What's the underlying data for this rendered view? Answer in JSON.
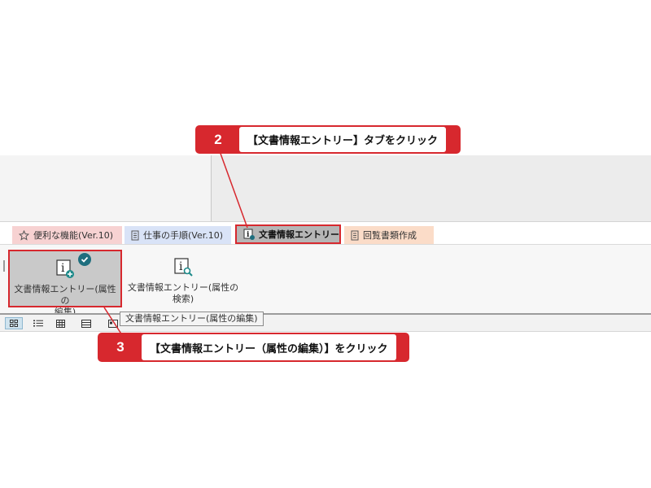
{
  "callouts": {
    "step2": {
      "number": "2",
      "text": "【文書情報エントリー】タブをクリック"
    },
    "step3": {
      "number": "3",
      "text": "【文書情報エントリー（属性の編集）】をクリック"
    }
  },
  "tabs": [
    {
      "label": "便利な機能(Ver.10)",
      "icon": "star-icon",
      "color": "#f7d2d2"
    },
    {
      "label": "仕事の手順(Ver.10)",
      "icon": "document-icon",
      "color": "#d9e3f7"
    },
    {
      "label": "文書情報エントリー",
      "icon": "info-icon",
      "color": "#b6b6b6",
      "selected": true
    },
    {
      "label": "回覧書類作成",
      "icon": "document-icon",
      "color": "#fbdcc8"
    }
  ],
  "ribbon": {
    "buttons": [
      {
        "label_line1": "文書情報エントリー(属性の",
        "label_line2": "編集)",
        "icon": "info-add-icon",
        "badge_icon": "check-icon"
      },
      {
        "label_line1": "文書情報エントリー(属性の",
        "label_line2": "検索)",
        "icon": "info-search-icon"
      }
    ]
  },
  "tooltip": {
    "text": "文書情報エントリー(属性の編集)"
  },
  "view_bar": {
    "icons": [
      "grid-view-icon",
      "list-view-icon",
      "table-view-icon",
      "detail-view-icon",
      "card-view-icon"
    ]
  },
  "colors": {
    "accent_red": "#d7282e",
    "check_badge": "#1e6e7e"
  }
}
